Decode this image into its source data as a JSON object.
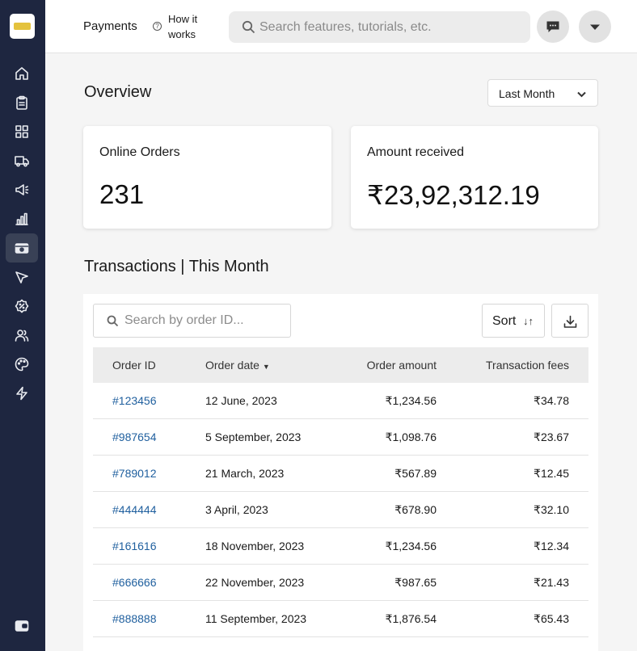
{
  "header": {
    "title": "Payments",
    "how_it_works": "How it works",
    "search_placeholder": "Search features, tutorials, etc."
  },
  "overview": {
    "title": "Overview",
    "period": "Last Month",
    "cards": [
      {
        "label": "Online Orders",
        "value": "231"
      },
      {
        "label": "Amount received",
        "value": "₹23,92,312.19"
      }
    ]
  },
  "transactions": {
    "title": "Transactions | This Month",
    "search_placeholder": "Search by order ID...",
    "sort_label": "Sort",
    "columns": [
      "Order ID",
      "Order date",
      "Order amount",
      "Transaction fees"
    ],
    "rows": [
      {
        "id": "#123456",
        "date": "12 June, 2023",
        "amount": "₹1,234.56",
        "fee": "₹34.78"
      },
      {
        "id": "#987654",
        "date": "5 September, 2023",
        "amount": "₹1,098.76",
        "fee": "₹23.67"
      },
      {
        "id": "#789012",
        "date": "21 March, 2023",
        "amount": "₹567.89",
        "fee": "₹12.45"
      },
      {
        "id": "#444444",
        "date": "3 April, 2023",
        "amount": "₹678.90",
        "fee": "₹32.10"
      },
      {
        "id": "#161616",
        "date": "18 November, 2023",
        "amount": "₹1,234.56",
        "fee": "₹12.34"
      },
      {
        "id": "#666666",
        "date": "22 November, 2023",
        "amount": "₹987.65",
        "fee": "₹21.43"
      },
      {
        "id": "#888888",
        "date": "11 September, 2023",
        "amount": "₹1,876.54",
        "fee": "₹65.43"
      }
    ]
  },
  "sidebar": {
    "items": [
      "home-icon",
      "orders-icon",
      "catalog-icon",
      "delivery-icon",
      "marketing-icon",
      "analytics-icon",
      "payments-icon",
      "discover-icon",
      "discounts-icon",
      "customers-icon",
      "appearance-icon",
      "plugins-icon"
    ],
    "active": "payments-icon"
  },
  "colors": {
    "sidebar": "#1e2640",
    "link": "#1f5f9e",
    "accent_logo": "#e4c23d"
  }
}
